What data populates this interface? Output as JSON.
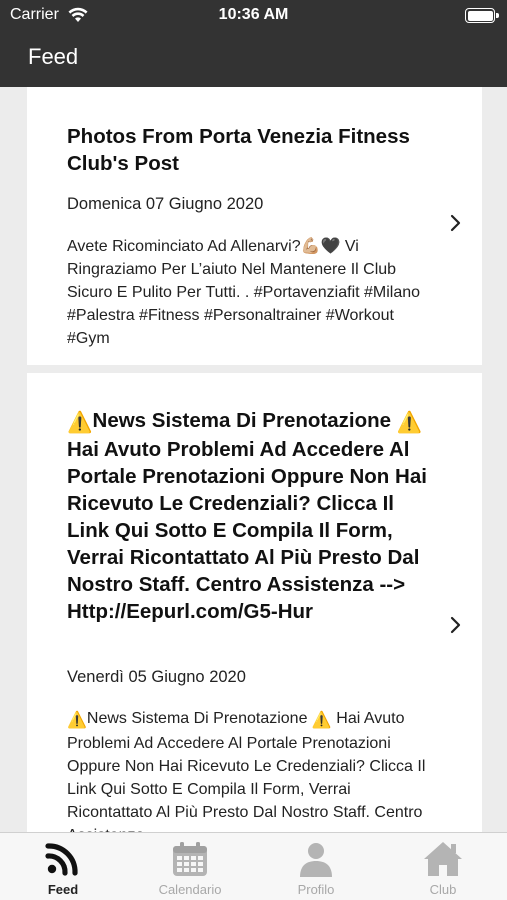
{
  "status_bar": {
    "carrier": "Carrier",
    "time": "10:36 AM"
  },
  "nav": {
    "title": "Feed"
  },
  "feed": {
    "items": [
      {
        "title": "Photos From Porta Venezia Fitness Club's Post",
        "date": "Domenica 07 Giugno 2020",
        "body": "Avete Ricominciato Ad Allenarvi?💪🏼🖤 Vi Ringraziamo Per L’aiuto Nel Mantenere Il Club Sicuro E Pulito Per Tutti. . #Portavenziafit #Milano #Palestra #Fitness #Personaltrainer #Workout #Gym"
      },
      {
        "title": "News Sistema Di Prenotazione  Hai Avuto Problemi Ad Accedere Al Portale Prenotazioni Oppure Non Hai Ricevuto Le Credenziali? Clicca Il Link Qui Sotto E Compila Il Form, Verrai Ricontattato Al Più Presto Dal Nostro Staff. Centro Assistenza --> Http://Eepurl.com/G5-Hur",
        "title_prefix": "⚠️",
        "title_part1": "News Sistema Di Prenotazione",
        "title_part2": "Hai Avuto Problemi Ad Accedere Al Portale Prenotazioni Oppure Non Hai Ricevuto Le Credenziali? Clicca Il Link Qui Sotto E Compila Il Form, Verrai Ricontattato Al Più Presto Dal Nostro Staff. Centro Assistenza --> Http://Eepurl.com/G5-Hur",
        "date": "Venerdì 05 Giugno 2020",
        "body_part1": "News Sistema Di Prenotazione",
        "body_part2": "Hai Avuto Problemi Ad Accedere Al Portale Prenotazioni Oppure Non Hai Ricevuto Le Credenziali? Clicca Il Link Qui Sotto E Compila Il Form, Verrai Ricontattato Al Più Presto Dal Nostro Staff. Centro Assistenza -"
      }
    ]
  },
  "tabbar": {
    "tabs": [
      {
        "label": "Feed",
        "icon": "rss-icon",
        "active": true
      },
      {
        "label": "Calendario",
        "icon": "calendar-icon",
        "active": false
      },
      {
        "label": "Profilo",
        "icon": "person-icon",
        "active": false
      },
      {
        "label": "Club",
        "icon": "home-icon",
        "active": false
      }
    ]
  },
  "colors": {
    "header": "#333333",
    "background": "#ececec",
    "tab_active": "#222222",
    "tab_inactive": "#a8a8a8"
  }
}
